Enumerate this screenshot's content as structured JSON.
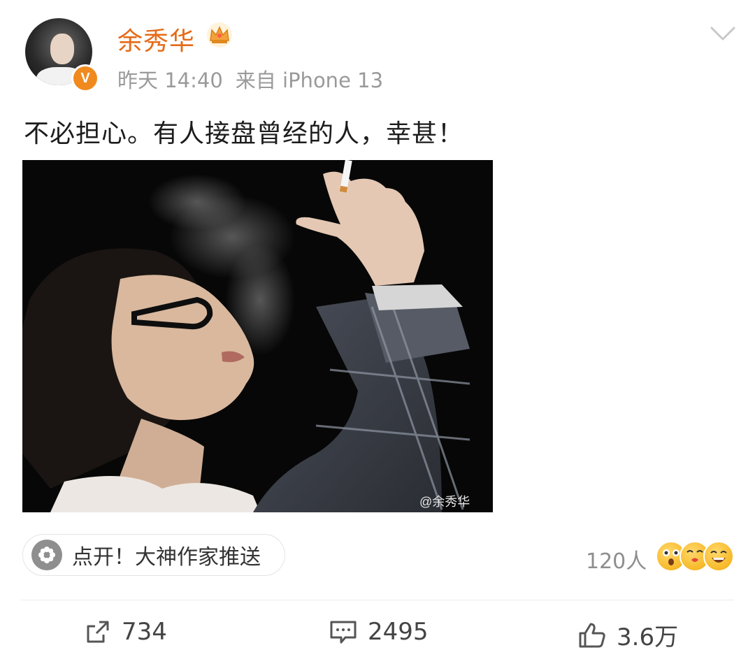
{
  "post": {
    "author": "余秀华",
    "time": "昨天 14:40",
    "source": "来自 iPhone 13",
    "text": "不必担心。有人接盘曾经的人，幸甚！",
    "image_watermark": "@余秀华",
    "verified_badge": "V"
  },
  "promo": {
    "label": "点开！大神作家推送",
    "icon": "flower-icon"
  },
  "reactions": {
    "count": "120人",
    "emojis": [
      "surprised-emoji",
      "kiss-emoji",
      "laugh-emoji"
    ]
  },
  "actions": {
    "repost": "734",
    "comment": "2495",
    "like": "3.6万"
  },
  "colors": {
    "accent": "#e56a17",
    "meta": "#9a9a9a"
  }
}
